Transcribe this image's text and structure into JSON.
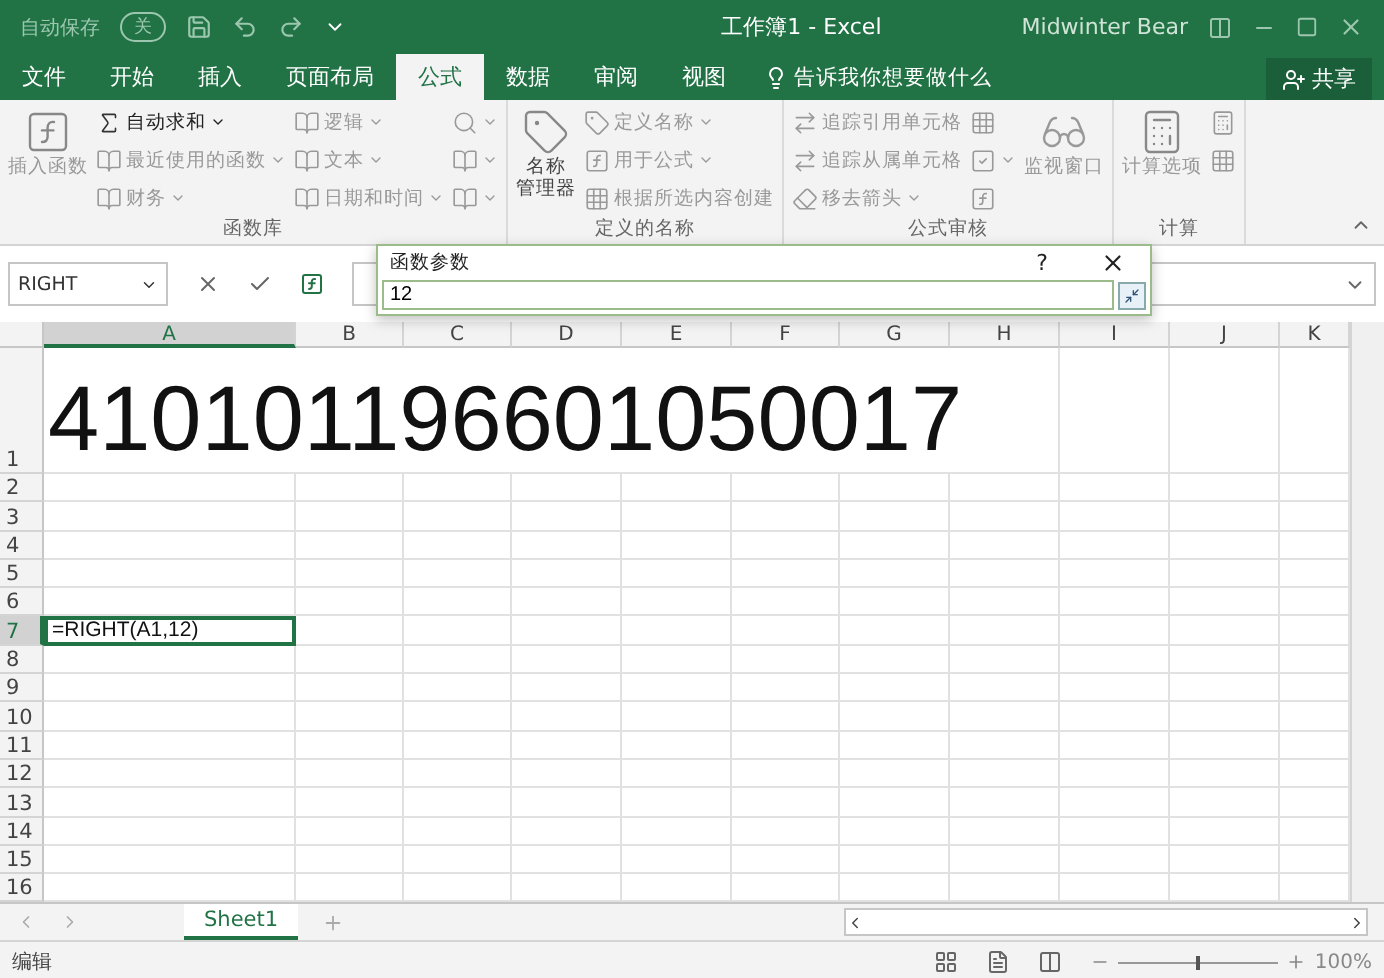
{
  "titlebar": {
    "autosave_label": "自动保存",
    "autosave_state": "关",
    "autosave_on": false,
    "title": "工作簿1  -  Excel",
    "user": "Midwinter Bear"
  },
  "tabs": [
    {
      "label": "文件",
      "selected": false
    },
    {
      "label": "开始",
      "selected": false
    },
    {
      "label": "插入",
      "selected": false
    },
    {
      "label": "页面布局",
      "selected": false
    },
    {
      "label": "公式",
      "selected": true
    },
    {
      "label": "数据",
      "selected": false
    },
    {
      "label": "审阅",
      "selected": false
    },
    {
      "label": "视图",
      "selected": false
    }
  ],
  "tell_me": "告诉我你想要做什么",
  "share": "共享",
  "ribbon_groups": [
    {
      "label": "函数库",
      "big": [
        {
          "lines": [
            "插入函数"
          ],
          "kind": "fx",
          "disabled": true
        }
      ],
      "columns": [
        [
          {
            "label": "自动求和",
            "kind": "sum",
            "disabled": false,
            "dropdown": true
          },
          {
            "label": "最近使用的函数",
            "kind": "book",
            "disabled": true,
            "dropdown": true
          },
          {
            "label": "财务",
            "kind": "book",
            "disabled": true,
            "dropdown": true
          }
        ],
        [
          {
            "label": "逻辑",
            "kind": "book",
            "disabled": true,
            "dropdown": true
          },
          {
            "label": "文本",
            "kind": "book",
            "disabled": true,
            "dropdown": true
          },
          {
            "label": "日期和时间",
            "kind": "book",
            "disabled": true,
            "dropdown": true
          }
        ],
        [
          {
            "kind": "search",
            "disabled": true,
            "dropdown": true
          },
          {
            "kind": "book",
            "disabled": true,
            "dropdown": true
          },
          {
            "kind": "book",
            "disabled": true,
            "dropdown": true
          }
        ]
      ]
    },
    {
      "label": "定义的名称",
      "big": [
        {
          "lines": [
            "名称",
            "管理器"
          ],
          "kind": "tag",
          "disabled": false
        }
      ],
      "columns": [
        [
          {
            "label": "定义名称",
            "kind": "tag",
            "disabled": true,
            "dropdown": true
          },
          {
            "label": "用于公式",
            "kind": "fx",
            "disabled": true,
            "dropdown": true
          },
          {
            "label": "根据所选内容创建",
            "kind": "grid",
            "disabled": true,
            "dropdown": false
          }
        ]
      ]
    },
    {
      "label": "公式审核",
      "columns": [
        [
          {
            "label": "追踪引用单元格",
            "kind": "arrow",
            "disabled": true,
            "dropdown": false
          },
          {
            "label": "追踪从属单元格",
            "kind": "arrow",
            "disabled": true,
            "dropdown": false
          },
          {
            "label": "移去箭头",
            "kind": "eraser",
            "disabled": true,
            "dropdown": true
          }
        ],
        [
          {
            "kind": "grid",
            "disabled": true,
            "dropdown": false
          },
          {
            "kind": "check",
            "disabled": true,
            "dropdown": true
          },
          {
            "kind": "fx",
            "disabled": true,
            "dropdown": false
          }
        ]
      ],
      "big_after": [
        {
          "lines": [
            "监视窗口"
          ],
          "kind": "glasses",
          "disabled": true
        }
      ]
    },
    {
      "label": "计算",
      "big": [
        {
          "lines": [
            "计算选项"
          ],
          "kind": "calc",
          "disabled": true
        }
      ],
      "columns": [
        [
          {
            "kind": "calc",
            "disabled": true,
            "dropdown": false
          },
          {
            "kind": "grid",
            "disabled": true,
            "dropdown": false
          }
        ]
      ]
    }
  ],
  "formula_bar": {
    "name_box": "RIGHT"
  },
  "dialog": {
    "title": "函数参数",
    "help": "?",
    "value": "12"
  },
  "columns": [
    {
      "label": "A",
      "selected": true
    },
    {
      "label": "B",
      "selected": false
    },
    {
      "label": "C",
      "selected": false
    },
    {
      "label": "D",
      "selected": false
    },
    {
      "label": "E",
      "selected": false
    },
    {
      "label": "F",
      "selected": false
    },
    {
      "label": "G",
      "selected": false
    },
    {
      "label": "H",
      "selected": false
    },
    {
      "label": "I",
      "selected": false
    },
    {
      "label": "J",
      "selected": false
    },
    {
      "label": "K",
      "selected": false
    }
  ],
  "rows": [
    {
      "label": "1",
      "kind": "tall",
      "value": "410101196601050017",
      "selected": false
    },
    {
      "label": "2",
      "kind": "normal",
      "selected": false
    },
    {
      "label": "3",
      "kind": "normal",
      "selected": false
    },
    {
      "label": "4",
      "kind": "normal",
      "selected": false
    },
    {
      "label": "5",
      "kind": "normal",
      "selected": false
    },
    {
      "label": "6",
      "kind": "normal",
      "selected": false
    },
    {
      "label": "7",
      "kind": "normal",
      "value": "=RIGHT(A1,12)",
      "selected": true
    },
    {
      "label": "8",
      "kind": "normal",
      "selected": false
    },
    {
      "label": "9",
      "kind": "normal",
      "selected": false
    },
    {
      "label": "10",
      "kind": "normal",
      "selected": false
    },
    {
      "label": "11",
      "kind": "normal",
      "selected": false
    },
    {
      "label": "12",
      "kind": "normal",
      "selected": false
    },
    {
      "label": "13",
      "kind": "normal",
      "selected": false
    },
    {
      "label": "14",
      "kind": "normal",
      "selected": false
    },
    {
      "label": "15",
      "kind": "normal",
      "selected": false
    },
    {
      "label": "16",
      "kind": "normal",
      "selected": false
    }
  ],
  "sheets": [
    {
      "label": "Sheet1",
      "selected": true
    }
  ],
  "status_bar": {
    "mode": "编辑",
    "zoom": "100%",
    "level": 0.5
  }
}
